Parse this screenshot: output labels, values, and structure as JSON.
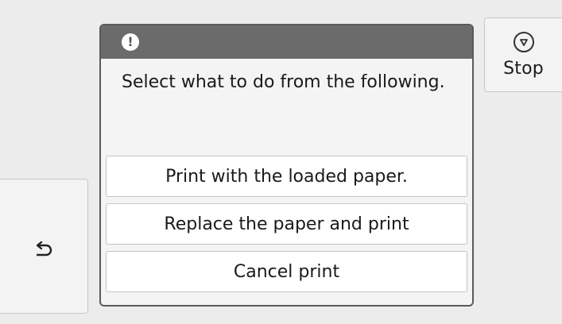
{
  "header": {
    "stop_label": "Stop"
  },
  "dialog": {
    "alert_icon": "!",
    "message": "Select what to do from the following.",
    "options": [
      {
        "label": "Print with the loaded paper."
      },
      {
        "label": "Replace the paper and print"
      },
      {
        "label": "Cancel print"
      }
    ]
  },
  "icons": {
    "stop": "stop-octagon-icon",
    "back": "back-arrow-icon",
    "alert": "exclamation-icon"
  },
  "colors": {
    "dialog_header": "#6b6b6b",
    "background": "#ececec",
    "button": "#ffffff"
  }
}
